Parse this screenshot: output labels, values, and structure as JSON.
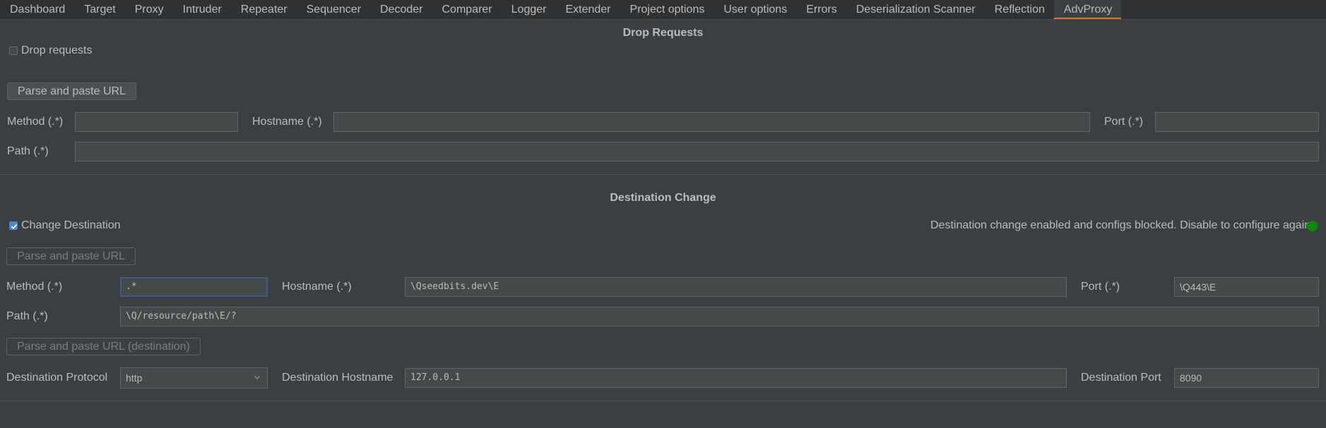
{
  "tabs": [
    {
      "label": "Dashboard"
    },
    {
      "label": "Target"
    },
    {
      "label": "Proxy"
    },
    {
      "label": "Intruder"
    },
    {
      "label": "Repeater"
    },
    {
      "label": "Sequencer"
    },
    {
      "label": "Decoder"
    },
    {
      "label": "Comparer"
    },
    {
      "label": "Logger"
    },
    {
      "label": "Extender"
    },
    {
      "label": "Project options"
    },
    {
      "label": "User options"
    },
    {
      "label": "Errors"
    },
    {
      "label": "Deserialization Scanner"
    },
    {
      "label": "Reflection"
    },
    {
      "label": "AdvProxy",
      "active": true
    }
  ],
  "drop": {
    "title": "Drop Requests",
    "checkbox_label": "Drop requests",
    "checked": false,
    "parse_button": "Parse and paste URL",
    "method_label": "Method (.*)",
    "method_value": "",
    "hostname_label": "Hostname (.*)",
    "hostname_value": "",
    "port_label": "Port (.*)",
    "port_value": "",
    "path_label": "Path (.*)",
    "path_value": ""
  },
  "dest": {
    "title": "Destination Change",
    "checkbox_label": "Change Destination",
    "checked": true,
    "status_text": "Destination change enabled and configs blocked. Disable to configure again",
    "status_color": "#0b8a0b",
    "parse_button": "Parse and paste URL",
    "method_label": "Method (.*)",
    "method_value": ".*",
    "hostname_label": "Hostname (.*)",
    "hostname_value": "\\Qseedbits.dev\\E",
    "port_label": "Port (.*)",
    "port_value": "\\Q443\\E",
    "path_label": "Path (.*)",
    "path_value": "\\Q/resource/path\\E/?",
    "parse_dest_button": "Parse and paste URL (destination)",
    "protocol_label": "Destination Protocol",
    "protocol_value": "http",
    "dest_hostname_label": "Destination Hostname",
    "dest_hostname_value": "127.0.0.1",
    "dest_port_label": "Destination Port",
    "dest_port_value": "8090"
  },
  "colors": {
    "accent_tab": "#e0703a",
    "checkbox_checked": "#4a88c7"
  }
}
